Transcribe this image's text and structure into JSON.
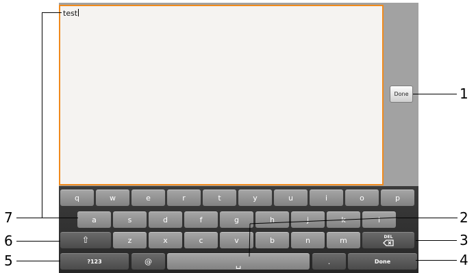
{
  "editor": {
    "text": "test"
  },
  "side_done_label": "Done",
  "keyboard": {
    "row1": [
      "q",
      "w",
      "e",
      "r",
      "t",
      "y",
      "u",
      "i",
      "o",
      "p"
    ],
    "row2": [
      "a",
      "s",
      "d",
      "f",
      "g",
      "h",
      "j",
      "k",
      "l"
    ],
    "row3": [
      "z",
      "x",
      "c",
      "v",
      "b",
      "n",
      "m"
    ],
    "shift_glyph": "⇧",
    "del_glyph": "DEL",
    "symbols_label": "?123",
    "at_label": "@",
    "space_glyph": "␣",
    "period_label": ".",
    "done_label": "Done"
  },
  "callouts": [
    "1",
    "2",
    "3",
    "4",
    "5",
    "6",
    "7"
  ]
}
